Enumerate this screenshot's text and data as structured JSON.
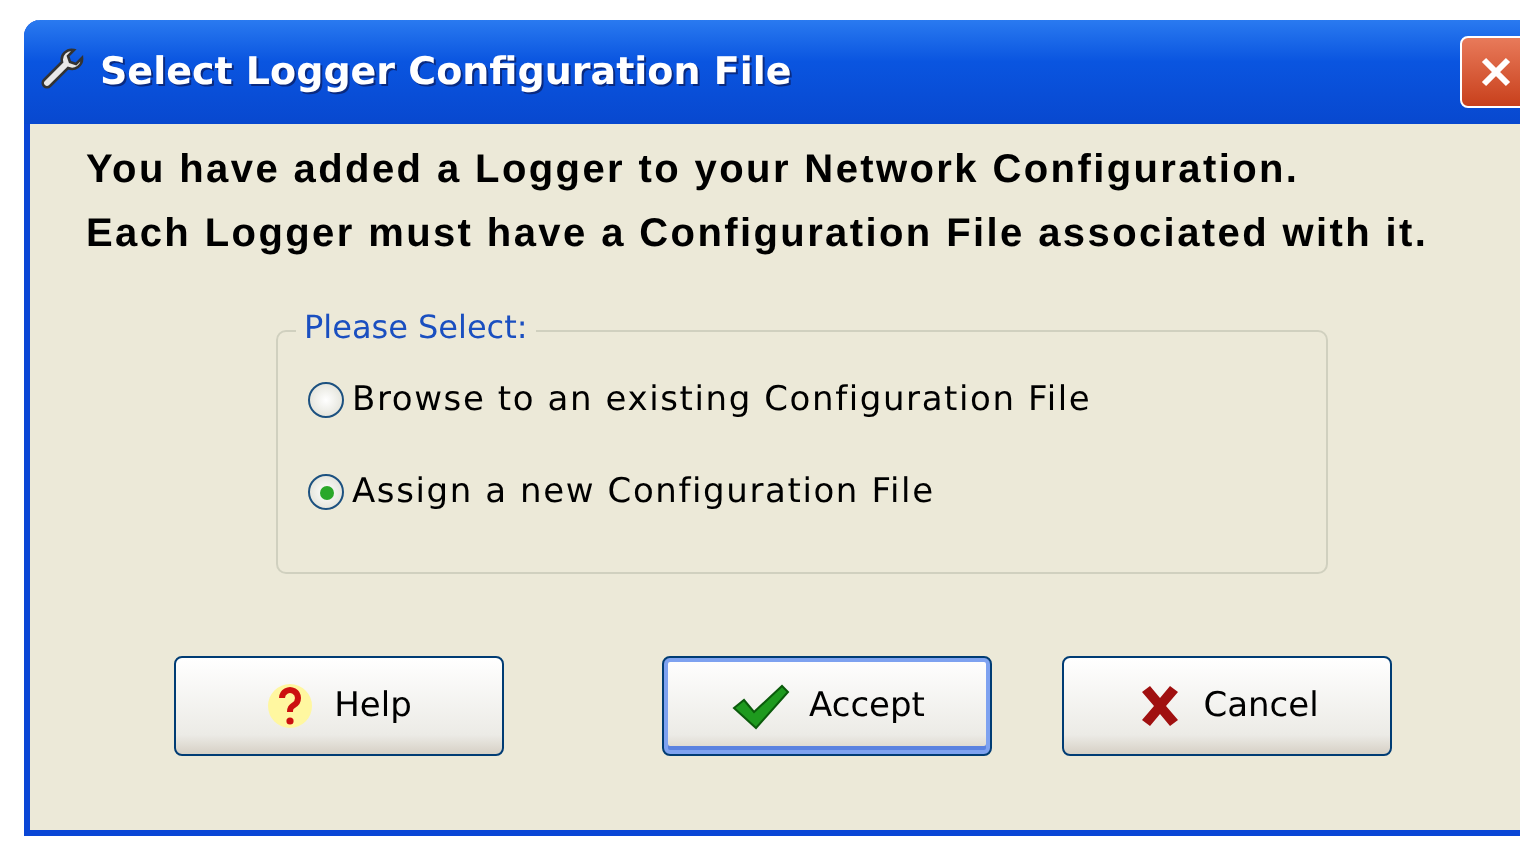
{
  "window": {
    "title": "Select Logger Configuration File"
  },
  "message": [
    "You have added a Logger to your Network Configuration.",
    "Each Logger must have a Configuration File associated with it."
  ],
  "group": {
    "legend": "Please Select:",
    "options": [
      {
        "label": "Browse to an existing Configuration File",
        "selected": false
      },
      {
        "label": "Assign a new Configuration File",
        "selected": true
      }
    ]
  },
  "buttons": [
    {
      "label": "Help",
      "kind": "help",
      "default": false
    },
    {
      "label": "Accept",
      "kind": "accept",
      "default": true
    },
    {
      "label": "Cancel",
      "kind": "cancel",
      "default": false
    }
  ]
}
